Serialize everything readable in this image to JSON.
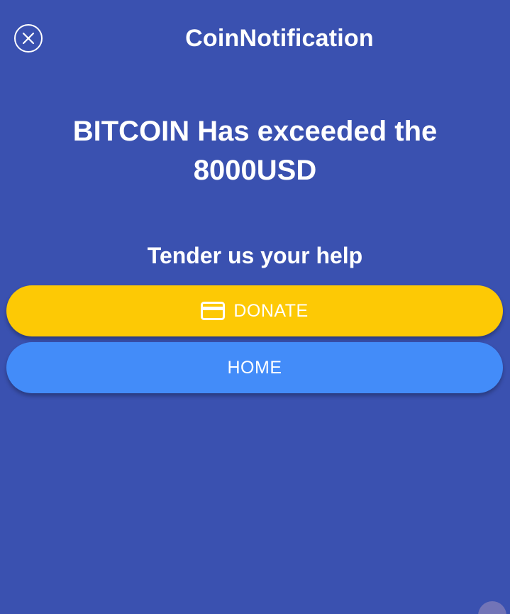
{
  "header": {
    "title": "CoinNotification",
    "close_icon": "close-circle-icon"
  },
  "main": {
    "headline": "BITCOIN Has exceeded the 8000USD",
    "subtitle": "Tender us your help"
  },
  "buttons": {
    "donate_label": "DONATE",
    "donate_icon": "credit-card-icon",
    "home_label": "HOME"
  },
  "colors": {
    "background": "#3a51b0",
    "donate": "#fdc905",
    "home": "#438cf9",
    "text": "#ffffff"
  }
}
